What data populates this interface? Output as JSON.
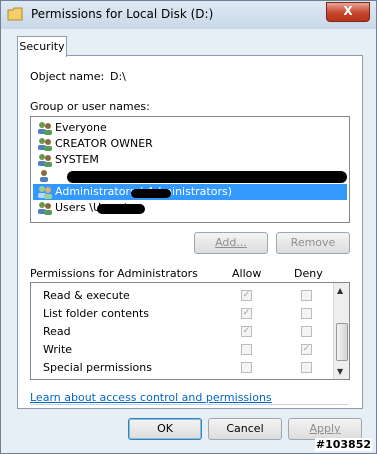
{
  "window": {
    "title": "Permissions for Local Disk (D:)",
    "close_label": "X"
  },
  "tab": {
    "label": "Security"
  },
  "object": {
    "label": "Object name:",
    "value": "D:\\"
  },
  "groups": {
    "label": "Group or user names:",
    "items": [
      {
        "label": "Everyone"
      },
      {
        "label": "CREATOR OWNER"
      },
      {
        "label": "SYSTEM"
      },
      {
        "label": ""
      },
      {
        "label": "Administrators (             Administrators)"
      },
      {
        "label": "Users                  \\Users)"
      }
    ],
    "selected_index": 4
  },
  "buttons": {
    "add": "Add...",
    "remove": "Remove",
    "ok": "OK",
    "cancel": "Cancel",
    "apply": "Apply"
  },
  "permissions": {
    "label": "Permissions for Administrators",
    "allow_header": "Allow",
    "deny_header": "Deny",
    "rows": [
      {
        "name": "Read & execute",
        "allow": true,
        "deny": false
      },
      {
        "name": "List folder contents",
        "allow": true,
        "deny": false
      },
      {
        "name": "Read",
        "allow": true,
        "deny": false
      },
      {
        "name": "Write",
        "allow": false,
        "deny": true
      },
      {
        "name": "Special permissions",
        "allow": false,
        "deny": false
      }
    ]
  },
  "help_link": "Learn about access control and permissions",
  "corner_tag": "#103852",
  "colors": {
    "selection": "#3399ff",
    "link": "#0066cc",
    "close": "#c4452d"
  }
}
